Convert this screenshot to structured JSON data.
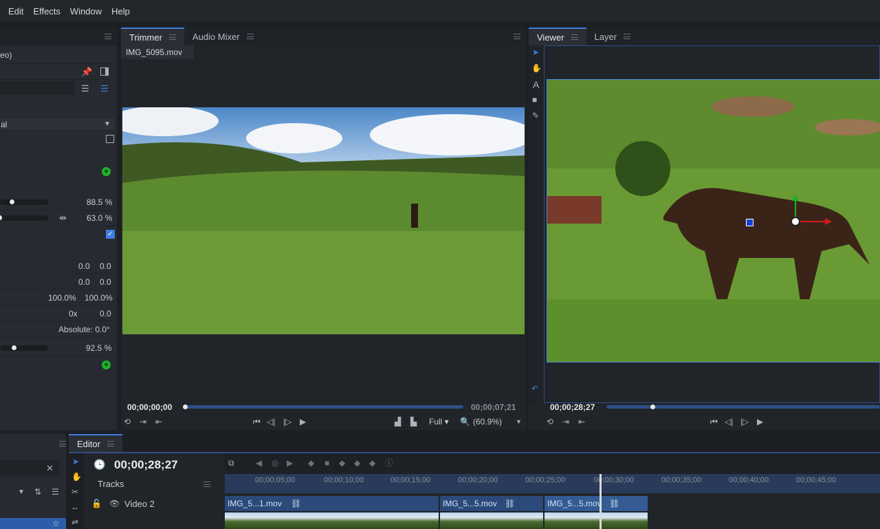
{
  "menu": [
    "Edit",
    "Effects",
    "Window",
    "Help"
  ],
  "left_panel": {
    "header_text": "eo)",
    "blend_mode": "al",
    "rows": [
      {
        "value": "88.5 %",
        "fill": 0.885
      },
      {
        "value": "63.0 %",
        "fill": 0.63
      }
    ],
    "xy_rows": [
      {
        "a": "0.0",
        "b": "0.0"
      },
      {
        "a": "0.0",
        "b": "0.0"
      },
      {
        "a": "100.0%",
        "b": "100.0%"
      },
      {
        "a": "0x",
        "b": "0.0"
      }
    ],
    "absolute": "Absolute: 0.0°",
    "opacity": {
      "value": "92.5 %",
      "fill": 0.925
    }
  },
  "trimmer": {
    "tabs": [
      "Trimmer",
      "Audio Mixer"
    ],
    "clip_name": "IMG_5095.mov",
    "timecode_start": "00;00;00;00",
    "timecode_end": "00;00;07;21",
    "quality": "Full",
    "zoom": "(60.9%)",
    "playhead": 0.0
  },
  "viewer": {
    "tabs": [
      "Viewer",
      "Layer"
    ],
    "timecode": "00;00;28;27",
    "playhead": 0.16
  },
  "editor": {
    "tab": "Editor",
    "timecode": "00;00;28;27",
    "tracks_label": "Tracks",
    "track_name": "Video 2",
    "ruler": [
      "00;00;05;00",
      "00;00;10;00",
      "00;00;15;00",
      "00;00;20;00",
      "00;00;25;00",
      "00;00;30;00",
      "00;00;35;00",
      "00;00;40;00",
      "00;00;45;00"
    ],
    "clips": [
      "IMG_5...1.mov",
      "IMG_5...5.mov",
      "IMG_5...5.mov"
    ]
  },
  "colors": {
    "accent": "#3d7fe0",
    "green": "#1fb52b",
    "panel": "#272a30"
  }
}
